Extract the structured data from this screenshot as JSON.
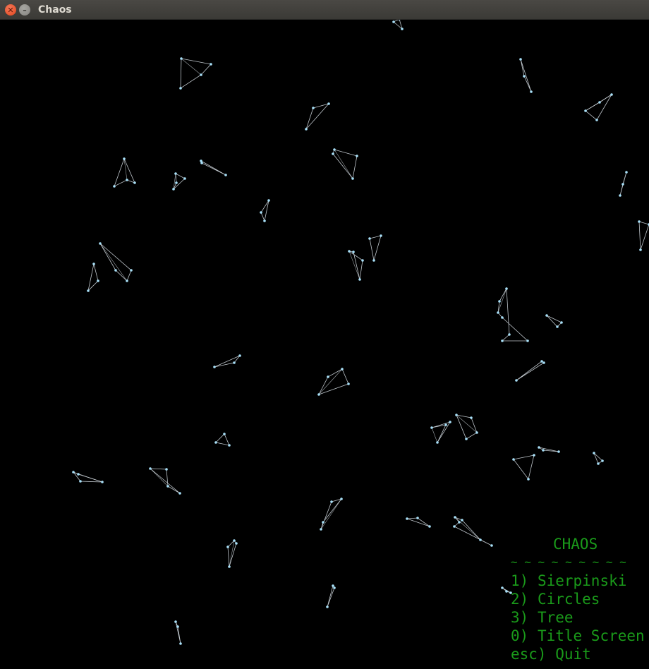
{
  "window": {
    "title": "Chaos",
    "close_icon": "close-icon",
    "minimize_icon": "minimize-icon"
  },
  "colors": {
    "background": "#000000",
    "shapes": "#dfe8ee",
    "points": "#a8e0f8",
    "menu_text": "#1a9a1a"
  },
  "menu": {
    "title": "CHAOS",
    "separator": "~ ~ ~ ~ ~ ~ ~ ~ ~",
    "items": [
      {
        "key": "1)",
        "label": "Sierpinski"
      },
      {
        "key": "2)",
        "label": "Circles"
      },
      {
        "key": "3)",
        "label": "Tree"
      },
      {
        "key": "0)",
        "label": "Title Screen"
      },
      {
        "key": "esc)",
        "label": "Quit"
      }
    ]
  }
}
